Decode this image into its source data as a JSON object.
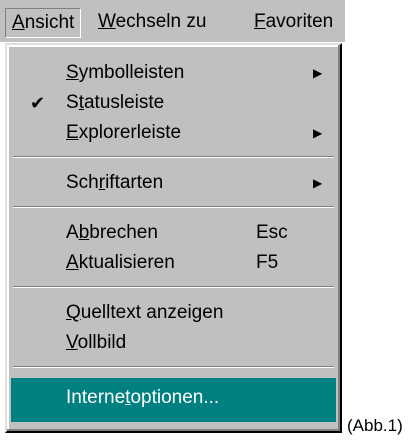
{
  "menubar": {
    "items": [
      {
        "pre": "",
        "ul": "A",
        "post": "nsicht"
      },
      {
        "pre": "",
        "ul": "W",
        "post": "echseln zu"
      },
      {
        "pre": "",
        "ul": "F",
        "post": "avoriten"
      }
    ]
  },
  "menu": {
    "items": [
      {
        "pre": "",
        "ul": "S",
        "post": "ymbolleisten",
        "icon": "submenu-arrow"
      },
      {
        "pre": "S",
        "ul": "t",
        "post": "atusleiste",
        "icon": "checkmark"
      },
      {
        "pre": "",
        "ul": "E",
        "post": "xplorerleiste",
        "icon": "submenu-arrow"
      },
      {
        "pre": "Sch",
        "ul": "r",
        "post": "iftarten",
        "icon": "submenu-arrow"
      },
      {
        "pre": "A",
        "ul": "b",
        "post": "brechen",
        "shortcut": "Esc"
      },
      {
        "pre": "",
        "ul": "A",
        "post": "ktualisieren",
        "shortcut": "F5"
      },
      {
        "pre": "",
        "ul": "Q",
        "post": "uelltext anzeigen"
      },
      {
        "pre": "",
        "ul": "V",
        "post": "ollbild"
      },
      {
        "pre": "Interne",
        "ul": "t",
        "post": "optionen..."
      }
    ],
    "check_glyph": "✔",
    "arrow_glyph": "▶",
    "highlight_color": "#008080"
  },
  "caption": "(Abb.1)"
}
